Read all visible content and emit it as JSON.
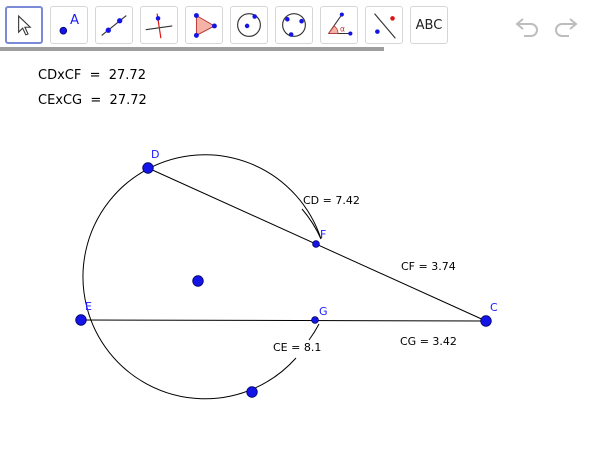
{
  "toolbar": {
    "tools": [
      {
        "name": "move-tool",
        "icon": "arrow-cursor-icon",
        "selected": true
      },
      {
        "name": "point-tool",
        "icon": "point-icon",
        "label": "A"
      },
      {
        "name": "line-tool",
        "icon": "line-through-points-icon"
      },
      {
        "name": "perpendicular-line-tool",
        "icon": "perpendicular-line-icon"
      },
      {
        "name": "polygon-tool",
        "icon": "polygon-icon"
      },
      {
        "name": "circle-center-point-tool",
        "icon": "circle-center-icon"
      },
      {
        "name": "circle-three-points-tool",
        "icon": "circle-three-points-icon"
      },
      {
        "name": "angle-tool",
        "icon": "angle-icon"
      },
      {
        "name": "reflect-tool",
        "icon": "reflect-about-line-icon"
      },
      {
        "name": "text-tool",
        "icon": "text-icon",
        "label": "ABC"
      }
    ],
    "undo_icon": "undo-icon",
    "redo_icon": "redo-icon",
    "progress": 0.64
  },
  "algebra": {
    "rows": [
      {
        "text": "CDxCF  =  27.72"
      },
      {
        "text": "CExCG  =  27.72"
      }
    ]
  },
  "construction": {
    "points": {
      "D": {
        "label": "D"
      },
      "F": {
        "label": "F"
      },
      "E": {
        "label": "E"
      },
      "G": {
        "label": "G"
      },
      "C": {
        "label": "C"
      }
    },
    "measurements": {
      "CD": "CD = 7.42",
      "CF": "CF = 3.74",
      "CE": "CE = 8.1",
      "CG": "CG = 3.42"
    }
  },
  "colors": {
    "point_fill": "#1414e6",
    "point_stroke": "#000066",
    "line": "#000000",
    "selected_border": "#7a8ad6",
    "progress": "#9e9e9e"
  }
}
